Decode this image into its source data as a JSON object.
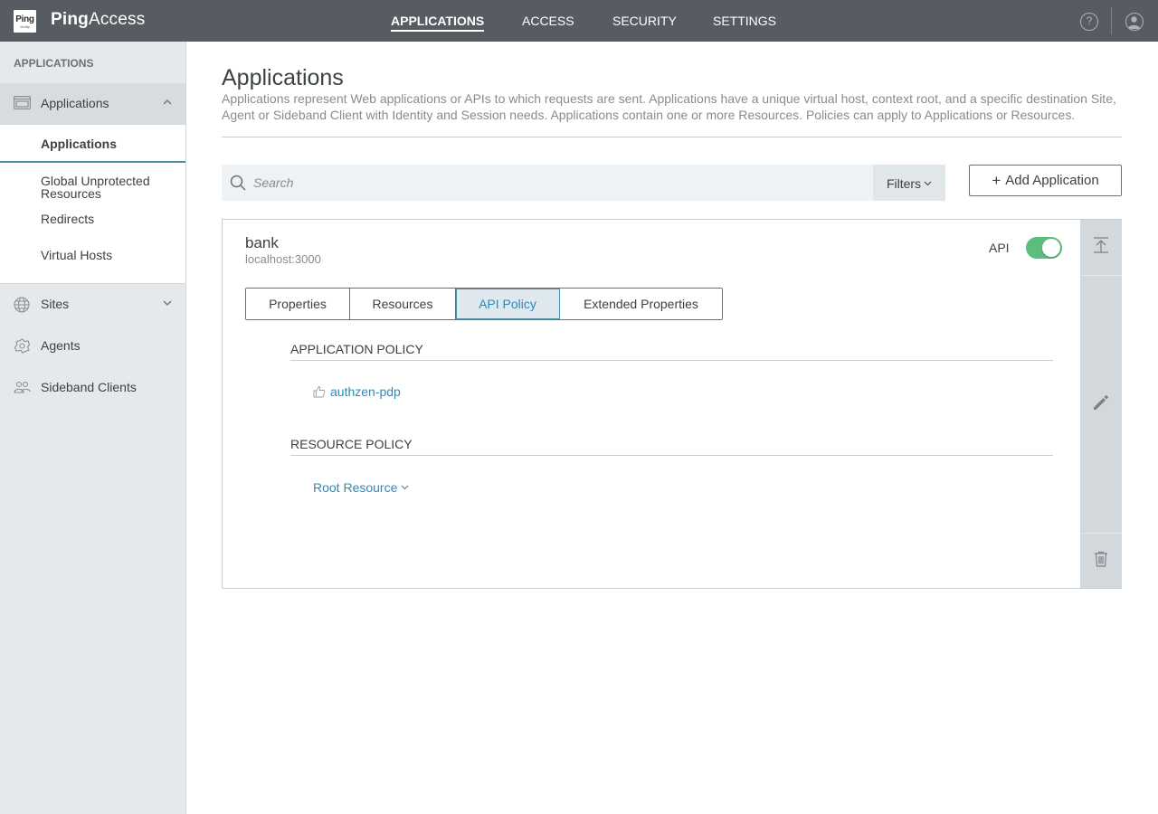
{
  "header": {
    "logo_text": "Ping",
    "logo_subtext": "Identity",
    "brand_bold": "Ping",
    "brand_rest": "Access",
    "nav": [
      {
        "label": "APPLICATIONS",
        "active": true
      },
      {
        "label": "ACCESS",
        "active": false
      },
      {
        "label": "SECURITY",
        "active": false
      },
      {
        "label": "SETTINGS",
        "active": false
      }
    ],
    "help_icon": "help-icon",
    "user_icon": "user-icon"
  },
  "sidebar": {
    "heading": "APPLICATIONS",
    "groups": [
      {
        "label": "Applications",
        "icon": "applications-icon",
        "expanded": true
      },
      {
        "label": "Sites",
        "icon": "globe-icon",
        "expanded": false
      },
      {
        "label": "Agents",
        "icon": "agents-icon"
      },
      {
        "label": "Sideband Clients",
        "icon": "sideband-icon"
      }
    ],
    "sub_items": [
      {
        "label": "Applications",
        "active": true
      },
      {
        "label": "Global Unprotected Resources",
        "active": false
      },
      {
        "label": "Redirects",
        "active": false
      },
      {
        "label": "Virtual Hosts",
        "active": false
      }
    ]
  },
  "main": {
    "title": "Applications",
    "description": "Applications represent Web applications or APIs to which requests are sent. Applications have a unique virtual host, context root, and a specific destination Site, Agent or Sideband Client with Identity and Session needs. Applications contain one or more Resources. Policies can apply to Applications or Resources.",
    "search_placeholder": "Search",
    "search_value": "",
    "filters_label": "Filters",
    "add_label": "Add Application"
  },
  "app": {
    "name": "bank",
    "host": "localhost:3000",
    "api_label": "API",
    "api_enabled": true,
    "tabs": [
      {
        "label": "Properties",
        "active": false
      },
      {
        "label": "Resources",
        "active": false
      },
      {
        "label": "API Policy",
        "active": true
      },
      {
        "label": "Extended Properties",
        "active": false
      }
    ],
    "application_policy_heading": "APPLICATION POLICY",
    "application_policy_rule": "authzen-pdp",
    "resource_policy_heading": "RESOURCE POLICY",
    "resource_link": "Root Resource"
  },
  "colors": {
    "topbar": "#565c62",
    "sidebar": "#e6e9ec",
    "link": "#2d8ab8",
    "toggle_on": "#5dbd7d",
    "active_underline": "#4b90aa"
  }
}
